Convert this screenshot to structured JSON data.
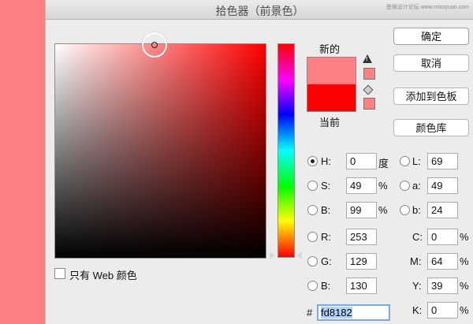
{
  "dialog": {
    "title": "拾色器（前景色）",
    "watermark": "思缘设计论坛  www.missyuan.com"
  },
  "colors": {
    "new": "#fd8182",
    "current": "#ff0000"
  },
  "preview": {
    "new_label": "新的",
    "current_label": "当前"
  },
  "buttons": {
    "ok": "确定",
    "cancel": "取消",
    "add_swatch": "添加到色板",
    "color_libraries": "颜色库"
  },
  "web_only": {
    "label": "只有 Web 颜色",
    "checked": false
  },
  "hsb": [
    {
      "label": "H:",
      "value": "0",
      "unit": "度",
      "selected": true
    },
    {
      "label": "S:",
      "value": "49",
      "unit": "%",
      "selected": false
    },
    {
      "label": "B:",
      "value": "99",
      "unit": "%",
      "selected": false
    }
  ],
  "rgb": [
    {
      "label": "R:",
      "value": "253"
    },
    {
      "label": "G:",
      "value": "129"
    },
    {
      "label": "B:",
      "value": "130"
    }
  ],
  "lab": [
    {
      "label": "L:",
      "value": "69"
    },
    {
      "label": "a:",
      "value": "49"
    },
    {
      "label": "b:",
      "value": "24"
    }
  ],
  "cmyk": [
    {
      "label": "C:",
      "value": "0",
      "unit": "%"
    },
    {
      "label": "M:",
      "value": "64",
      "unit": "%"
    },
    {
      "label": "Y:",
      "value": "39",
      "unit": "%"
    },
    {
      "label": "K:",
      "value": "0",
      "unit": "%"
    }
  ],
  "hex": {
    "prefix": "#",
    "value": "fd8182"
  },
  "icons": {
    "gamut_warning": "warning-triangle-icon",
    "web_safe": "cube-icon"
  }
}
